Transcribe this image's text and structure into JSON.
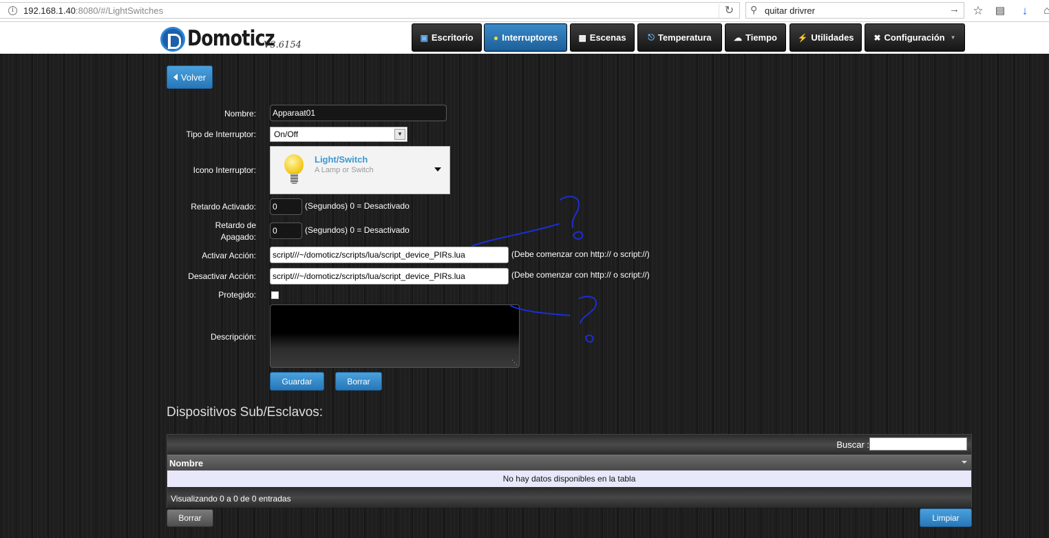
{
  "browser": {
    "url_host": "192.168.1.40",
    "url_port": ":8080",
    "url_path": "/#/LightSwitches",
    "search_value": "quitar drivrer"
  },
  "app": {
    "logo_text": "Domoticz",
    "version": "V3.6154",
    "nav": [
      {
        "label": "Escritorio",
        "icon": "desktop-icon"
      },
      {
        "label": "Interruptores",
        "icon": "lightbulb-icon",
        "active": true
      },
      {
        "label": "Escenas",
        "icon": "clapperboard-icon"
      },
      {
        "label": "Temperatura",
        "icon": "thermometer-icon"
      },
      {
        "label": "Tiempo",
        "icon": "weather-icon"
      },
      {
        "label": "Utilidades",
        "icon": "utility-icon"
      },
      {
        "label": "Configuración",
        "icon": "tools-icon",
        "dropdown": true
      }
    ]
  },
  "form": {
    "back_label": "Volver",
    "name_label": "Nombre:",
    "name_value": "Apparaat01",
    "type_label": "Tipo de Interruptor:",
    "type_value": "On/Off",
    "icon_label": "Icono Interruptor:",
    "icon_title": "Light/Switch",
    "icon_sub": "A Lamp or Switch",
    "on_delay_label": "Retardo Activado:",
    "on_delay_value": "0",
    "off_delay_label_1": "Retardo de",
    "off_delay_label_2": "Apagado:",
    "off_delay_value": "0",
    "delay_hint": "(Segundos) 0 = Desactivado",
    "on_action_label": "Activar Acción:",
    "on_action_value": "script///~/domoticz/scripts/lua/script_device_PIRs.lua",
    "off_action_label": "Desactivar Acción:",
    "off_action_value": "script///~/domoticz/scripts/lua/script_device_PIRs.lua",
    "action_hint": "(Debe comenzar con http:// o script://)",
    "protected_label": "Protegido:",
    "protected_checked": false,
    "description_label": "Descripción:",
    "description_value": "",
    "save_label": "Guardar",
    "clear_label": "Borrar"
  },
  "subdevices": {
    "title": "Dispositivos Sub/Esclavos:",
    "search_label": "Buscar :",
    "search_value": "",
    "column_name": "Nombre",
    "empty_text": "No hay datos disponibles en la tabla",
    "info_text": "Visualizando 0 a 0 de 0 entradas",
    "delete_label": "Borrar",
    "clear_label": "Limpiar"
  },
  "colors": {
    "accent_blue": "#2f86c7",
    "annotation_ink": "#1a2fd8"
  }
}
